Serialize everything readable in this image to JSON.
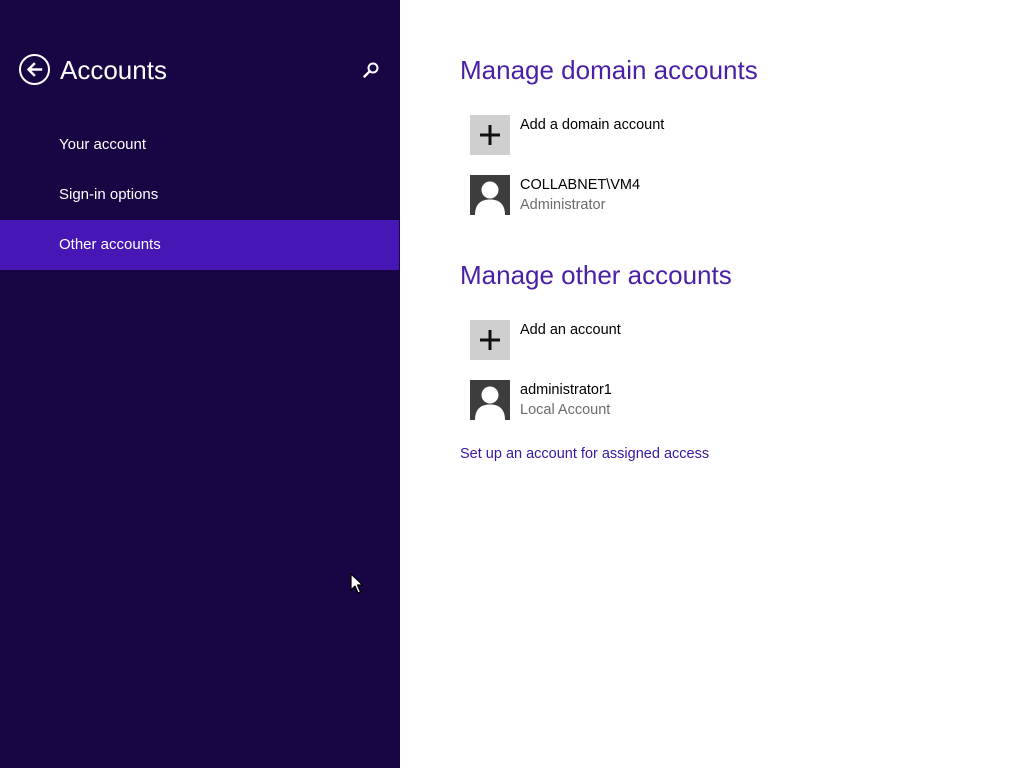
{
  "sidebar": {
    "title": "Accounts",
    "back_icon": "back-arrow-icon",
    "search_icon": "search-icon",
    "items": [
      {
        "label": "Your account",
        "selected": false
      },
      {
        "label": "Sign-in options",
        "selected": false
      },
      {
        "label": "Other accounts",
        "selected": true
      }
    ]
  },
  "main": {
    "domain_section": {
      "heading": "Manage domain accounts",
      "add_label": "Add a domain account",
      "accounts": [
        {
          "name": "COLLABNET\\VM4",
          "role": "Administrator"
        }
      ]
    },
    "other_section": {
      "heading": "Manage other accounts",
      "add_label": "Add an account",
      "accounts": [
        {
          "name": "administrator1",
          "role": "Local Account"
        }
      ]
    },
    "assigned_access_link": "Set up an account for assigned access"
  },
  "colors": {
    "sidebar_bg": "#180544",
    "selected_bg": "#4617b4",
    "heading": "#4a1fa6",
    "link": "#3b15a3"
  }
}
